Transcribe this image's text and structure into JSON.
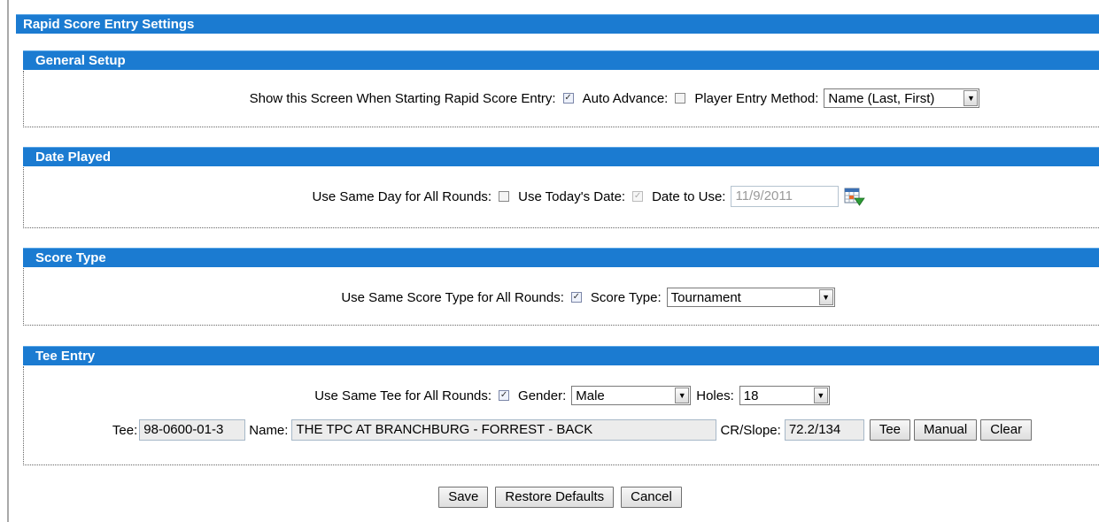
{
  "window": {
    "title": "Rapid Score Entry Settings"
  },
  "general_setup": {
    "header": "General Setup",
    "show_screen_label": "Show this Screen When Starting Rapid Score Entry:",
    "show_screen_checked": true,
    "auto_advance_label": "Auto Advance:",
    "auto_advance_checked": false,
    "player_entry_label": "Player Entry Method:",
    "player_entry_value": "Name (Last, First)"
  },
  "date_played": {
    "header": "Date Played",
    "same_day_label": "Use Same Day for All Rounds:",
    "same_day_checked": false,
    "todays_date_label": "Use Today's Date:",
    "todays_date_checked": true,
    "date_to_use_label": "Date to Use:",
    "date_to_use_value": "11/9/2011"
  },
  "score_type": {
    "header": "Score Type",
    "same_score_type_label": "Use Same Score Type for All Rounds:",
    "same_score_type_checked": true,
    "score_type_label": "Score Type:",
    "score_type_value": "Tournament"
  },
  "tee_entry": {
    "header": "Tee Entry",
    "same_tee_label": "Use Same Tee for All Rounds:",
    "same_tee_checked": true,
    "gender_label": "Gender:",
    "gender_value": "Male",
    "holes_label": "Holes:",
    "holes_value": "18",
    "tee_label": "Tee:",
    "tee_value": "98-0600-01-3",
    "name_label": "Name:",
    "name_value": "THE TPC AT BRANCHBURG - FORREST - BACK",
    "cr_slope_label": "CR/Slope:",
    "cr_slope_value": "72.2/134",
    "tee_button": "Tee",
    "manual_button": "Manual",
    "clear_button": "Clear"
  },
  "footer": {
    "save_button": "Save",
    "restore_button": "Restore Defaults",
    "cancel_button": "Cancel"
  },
  "icons": {
    "checkbox_check": "✓",
    "dropdown_arrow": "▼",
    "calendar_icon": "calendar-icon"
  },
  "colors": {
    "header_blue": "#1b7bd1",
    "header_text": "#ffffff"
  }
}
